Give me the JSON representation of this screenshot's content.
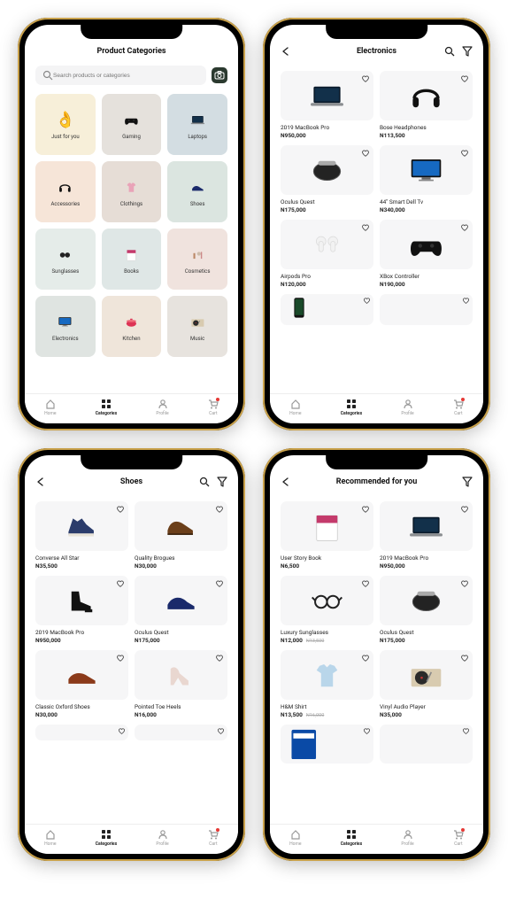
{
  "nav": {
    "home": "Home",
    "categories": "Categories",
    "profile": "Profile",
    "cart": "Cart"
  },
  "screen1": {
    "title": "Product Categories",
    "search_placeholder": "Search products or categories",
    "categories": [
      {
        "label": "Just for you"
      },
      {
        "label": "Gaming"
      },
      {
        "label": "Laptops"
      },
      {
        "label": "Accessories"
      },
      {
        "label": "Clothings"
      },
      {
        "label": "Shoes"
      },
      {
        "label": "Sunglasses"
      },
      {
        "label": "Books"
      },
      {
        "label": "Cosmetics"
      },
      {
        "label": "Electronics"
      },
      {
        "label": "Kitchen"
      },
      {
        "label": "Music"
      }
    ]
  },
  "screen2": {
    "title": "Electronics",
    "products": [
      {
        "name": "2019 MacBook Pro",
        "price": "N950,000"
      },
      {
        "name": "Bose Headphones",
        "price": "N113,500"
      },
      {
        "name": "Oculus Quest",
        "price": "N175,000"
      },
      {
        "name": "44'' Smart Dell Tv",
        "price": "N340,000"
      },
      {
        "name": "Airpods Pro",
        "price": "N120,000"
      },
      {
        "name": "XBox Controller",
        "price": "N190,000"
      }
    ]
  },
  "screen3": {
    "title": "Shoes",
    "products": [
      {
        "name": "Converse All Star",
        "price": "N35,500"
      },
      {
        "name": "Quality Brogues",
        "price": "N30,000"
      },
      {
        "name": "2019 MacBook Pro",
        "price": "N950,000"
      },
      {
        "name": "Oculus Quest",
        "price": "N175,000"
      },
      {
        "name": "Classic Oxford Shoes",
        "price": "N30,000"
      },
      {
        "name": "Pointed Toe Heels",
        "price": "N16,000"
      }
    ]
  },
  "screen4": {
    "title": "Recommended for you",
    "products": [
      {
        "name": "User Story Book",
        "price": "N6,500"
      },
      {
        "name": "2019 MacBook Pro",
        "price": "N950,000"
      },
      {
        "name": "Luxury Sunglasses",
        "price": "N12,000",
        "old": "N13,500"
      },
      {
        "name": "Oculus Quest",
        "price": "N175,000"
      },
      {
        "name": "H&M Shirt",
        "price": "N13,500",
        "old": "N16,000"
      },
      {
        "name": "Vinyl Audio Player",
        "price": "N35,000"
      }
    ]
  }
}
